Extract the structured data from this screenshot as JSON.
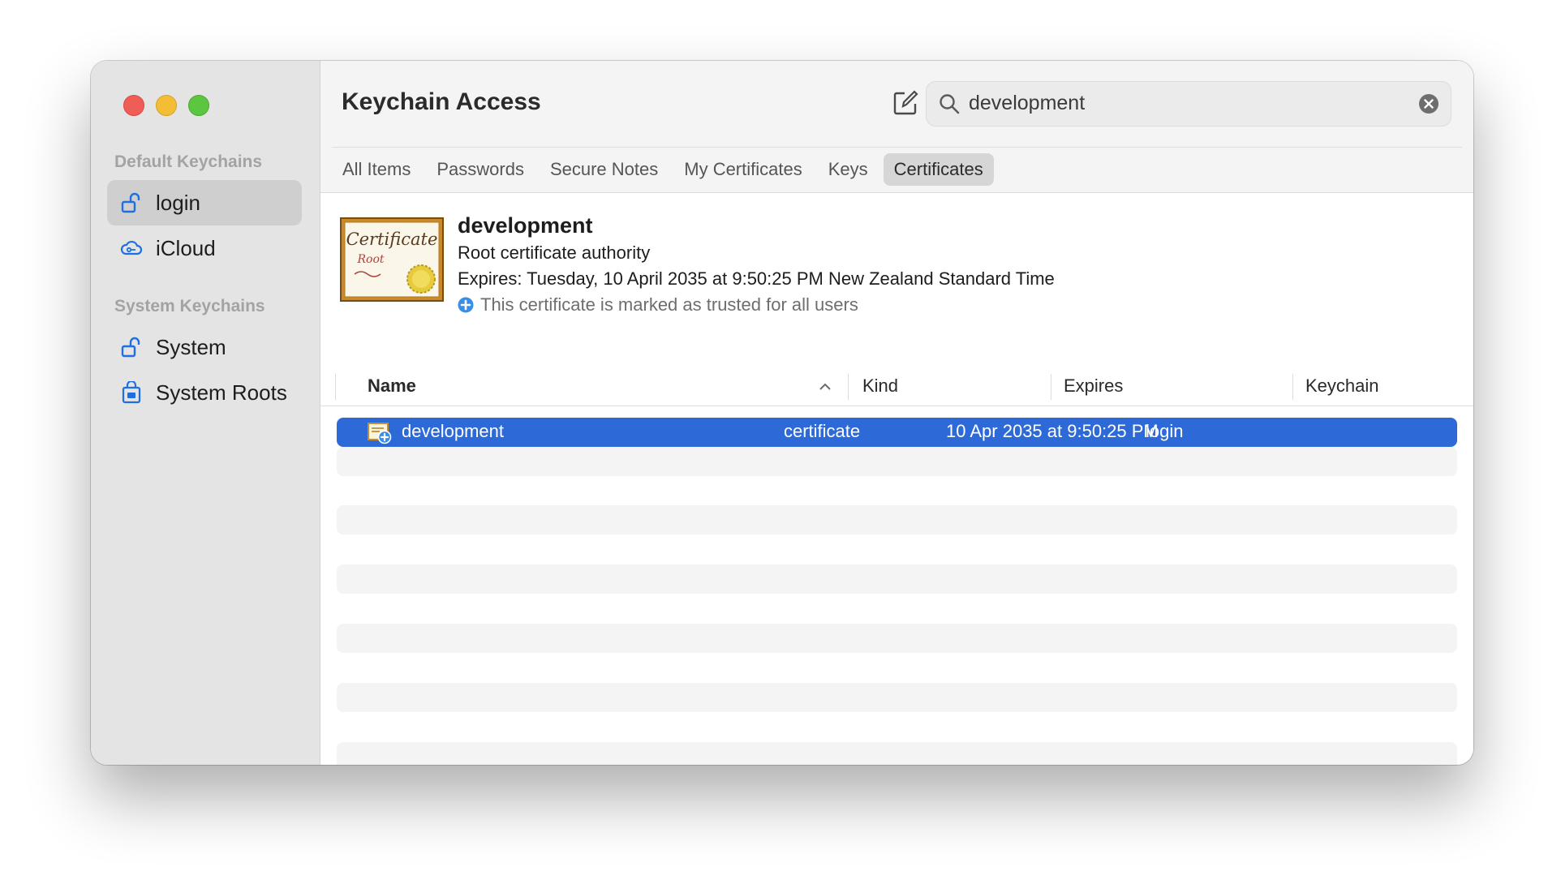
{
  "app": {
    "title": "Keychain Access"
  },
  "sidebar": {
    "default_title": "Default Keychains",
    "system_title": "System Keychains",
    "items": [
      {
        "label": "login",
        "icon": "unlocked-padlock-icon",
        "selected": true
      },
      {
        "label": "iCloud",
        "icon": "icloud-key-icon",
        "selected": false
      },
      {
        "label": "System",
        "icon": "unlocked-padlock-icon",
        "selected": false
      },
      {
        "label": "System Roots",
        "icon": "locked-cabinet-icon",
        "selected": false
      }
    ]
  },
  "toolbar": {
    "compose_icon": "compose-icon",
    "info_icon": "info-icon"
  },
  "search": {
    "value": "development",
    "placeholder": "Search"
  },
  "tabs": [
    {
      "label": "All Items",
      "active": false
    },
    {
      "label": "Passwords",
      "active": false
    },
    {
      "label": "Secure Notes",
      "active": false
    },
    {
      "label": "My Certificates",
      "active": false
    },
    {
      "label": "Keys",
      "active": false
    },
    {
      "label": "Certificates",
      "active": true
    }
  ],
  "detail": {
    "name": "development",
    "kind": "Root certificate authority",
    "expires": "Expires: Tuesday, 10 April 2035 at 9:50:25 PM New Zealand Standard Time",
    "trust": "This certificate is marked as trusted for all users",
    "cert_title": "Certificate",
    "cert_sub": "Root"
  },
  "columns": {
    "name": "Name",
    "kind": "Kind",
    "expires": "Expires",
    "keychain": "Keychain"
  },
  "rows": [
    {
      "name": "development",
      "kind": "certificate",
      "expires": "10 Apr 2035 at 9:50:25 PM",
      "keychain": "login",
      "selected": true
    }
  ],
  "colors": {
    "accent": "#2d6ad8",
    "sidebar_icon": "#1f6fe0",
    "trust_icon": "#3a8ee6"
  }
}
